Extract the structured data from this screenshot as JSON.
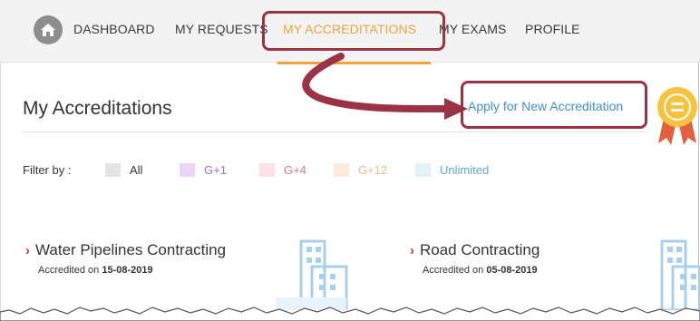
{
  "nav": {
    "items": [
      {
        "label": "DASHBOARD"
      },
      {
        "label": "MY REQUESTS"
      },
      {
        "label": "MY ACCREDITATIONS"
      },
      {
        "label": "MY EXAMS"
      },
      {
        "label": "PROFILE"
      }
    ],
    "active_index": 2,
    "active_color": "#f0a43c"
  },
  "page": {
    "title": "My Accreditations",
    "apply_link": "Apply for New Accreditation"
  },
  "filter": {
    "label": "Filter by :",
    "options": [
      {
        "label": "All",
        "swatch": "#e4e4e4",
        "text_color": "#333333"
      },
      {
        "label": "G+1",
        "swatch": "#ead7f5",
        "text_color": "#a66ad6"
      },
      {
        "label": "G+4",
        "swatch": "#fbe3e6",
        "text_color": "#e07a86"
      },
      {
        "label": "G+12",
        "swatch": "#fcebdd",
        "text_color": "#f3b98b"
      },
      {
        "label": "Unlimited",
        "swatch": "#e5f1f8",
        "text_color": "#5fa6d4"
      }
    ]
  },
  "cards": [
    {
      "title": "Water Pipelines  Contracting",
      "accredited_prefix": "Accredited on ",
      "date": "15-08-2019"
    },
    {
      "title": "Road Contracting",
      "accredited_prefix": "Accredited on ",
      "date": "05-08-2019"
    }
  ],
  "annotation_color": "#9a3346",
  "link_color": "#3d8fd1"
}
